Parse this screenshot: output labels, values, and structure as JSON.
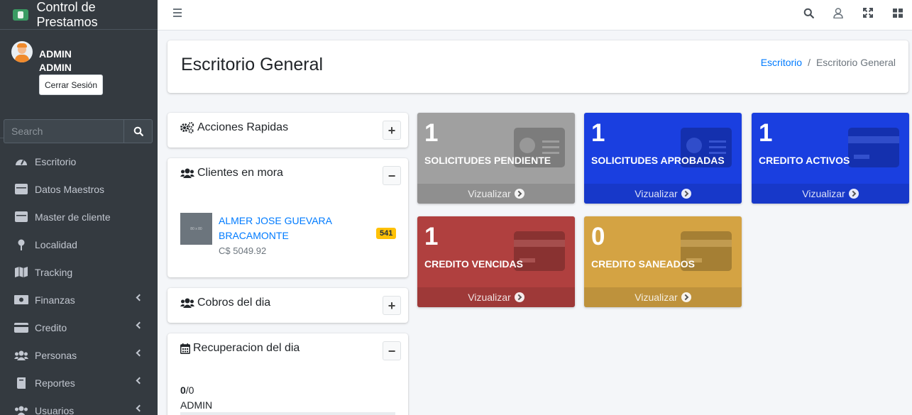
{
  "brand": {
    "title": "Control de Prestamos"
  },
  "user": {
    "name": "ADMIN",
    "role": "ADMIN",
    "logout_label": "Cerrar Sesión"
  },
  "search": {
    "placeholder": "Search"
  },
  "sidebar": {
    "items": [
      {
        "label": "Escritorio",
        "icon": "tachometer-icon",
        "has_submenu": false
      },
      {
        "label": "Datos Maestros",
        "icon": "table-icon",
        "has_submenu": false
      },
      {
        "label": "Master de cliente",
        "icon": "table-icon",
        "has_submenu": false
      },
      {
        "label": "Localidad",
        "icon": "map-pin-icon",
        "has_submenu": false
      },
      {
        "label": "Tracking",
        "icon": "map-icon",
        "has_submenu": false
      },
      {
        "label": "Finanzas",
        "icon": "money-bill-icon",
        "has_submenu": true
      },
      {
        "label": "Credito",
        "icon": "credit-card-icon",
        "has_submenu": true
      },
      {
        "label": "Personas",
        "icon": "users-icon",
        "has_submenu": true
      },
      {
        "label": "Reportes",
        "icon": "file-icon",
        "has_submenu": true
      },
      {
        "label": "Usuarios",
        "icon": "users-icon",
        "has_submenu": true
      }
    ]
  },
  "topbar": {
    "icons": [
      "search-icon",
      "user-icon",
      "expand-icon",
      "grid-icon"
    ]
  },
  "header": {
    "title": "Escritorio General",
    "breadcrumb": [
      "Escritorio",
      "Escritorio General"
    ]
  },
  "cards": {
    "acciones": {
      "title": "Acciones Rapidas",
      "tool": "+"
    },
    "clientes_mora": {
      "title": "Clientes en mora",
      "tool": "−",
      "item": {
        "image_text": "80 x 80",
        "name": "ALMER JOSE GUEVARA BRACAMONTE",
        "amount": "C$ 5049.92",
        "badge": "541"
      }
    },
    "cobros": {
      "title": "Cobros del dia",
      "tool": "+"
    },
    "recuperacion": {
      "title": "Recuperacion del dia",
      "tool": "−",
      "count_bold": "0",
      "count_rest": "/0",
      "user": "ADMIN"
    }
  },
  "stats": [
    {
      "value": "1",
      "label": "SOLICITUDES PENDIENTE",
      "footer": "Vizualizar",
      "color": "#a0a0a0"
    },
    {
      "value": "1",
      "label": "SOLICITUDES APROBADAS",
      "footer": "Vizualizar",
      "color": "#1a3fe0"
    },
    {
      "value": "1",
      "label": "CREDITO ACTIVOS",
      "footer": "Vizualizar",
      "color": "#1a3fe0"
    },
    {
      "value": "1",
      "label": "CREDITO VENCIDAS",
      "footer": "Vizualizar",
      "color": "#b0403f"
    },
    {
      "value": "0",
      "label": "CREDITO SANEADOS",
      "footer": "Vizualizar",
      "color": "#d4a343"
    }
  ]
}
